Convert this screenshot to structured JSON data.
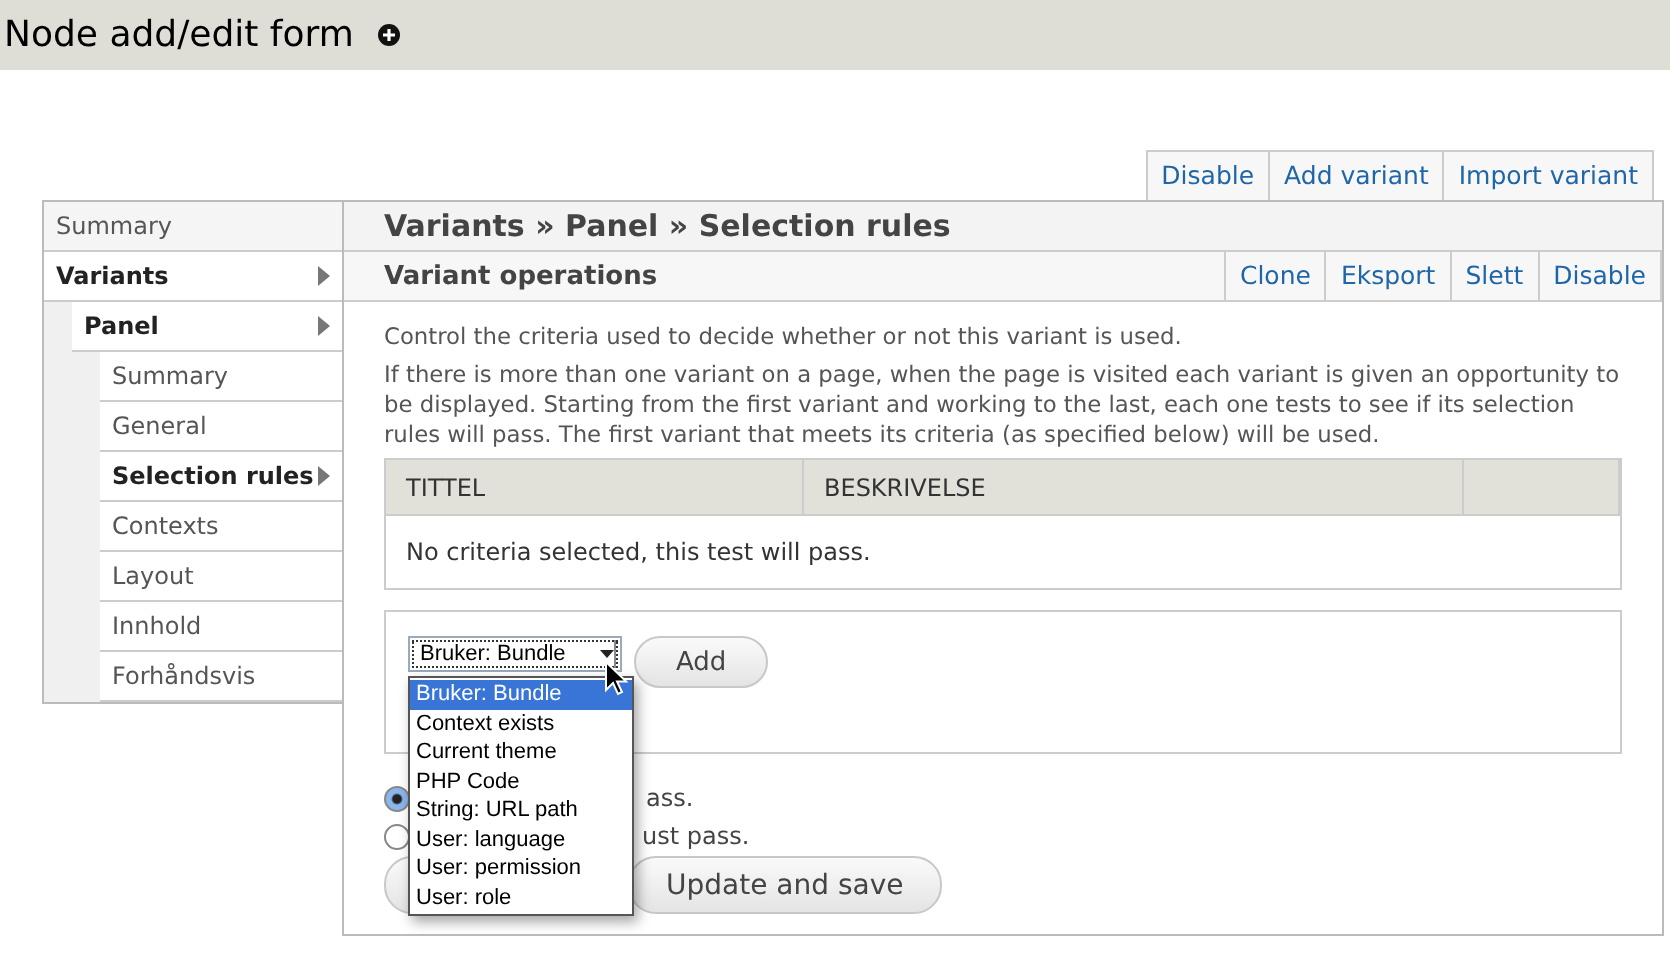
{
  "header": {
    "title": "Node add/edit form"
  },
  "top_actions": [
    "Disable",
    "Add variant",
    "Import variant"
  ],
  "sidebar": {
    "items": [
      {
        "label": "Summary",
        "active": false
      },
      {
        "label": "Variants",
        "active": true,
        "children": [
          {
            "label": "Panel",
            "active": true,
            "children": [
              {
                "label": "Summary",
                "active": false
              },
              {
                "label": "General",
                "active": false
              },
              {
                "label": "Selection rules",
                "active": true
              },
              {
                "label": "Contexts",
                "active": false
              },
              {
                "label": "Layout",
                "active": false
              },
              {
                "label": "Innhold",
                "active": false
              },
              {
                "label": "Forhåndsvis",
                "active": false
              }
            ]
          }
        ]
      }
    ]
  },
  "main": {
    "breadcrumb": "Variants » Panel » Selection rules",
    "operations": {
      "title": "Variant operations",
      "actions": [
        "Clone",
        "Eksport",
        "Slett",
        "Disable"
      ]
    },
    "intro": "Control the criteria used to decide whether or not this variant is used.",
    "description": "If there is more than one variant on a page, when the page is visited each variant is given an opportunity to be displayed. Starting from the first variant and working to the last, each one tests to see if its selection rules will pass. The first variant that meets its criteria (as specified below) will be used.",
    "table": {
      "columns": [
        "TITTEL",
        "BESKRIVELSE"
      ],
      "empty_text": "No criteria selected, this test will pass."
    },
    "criteria": {
      "select": {
        "value": "Bruker: Bundle",
        "expanded": true,
        "options": [
          {
            "label": "Bruker: Bundle",
            "selected": true
          },
          {
            "label": "Context exists",
            "selected": false
          },
          {
            "label": "Current theme",
            "selected": false
          },
          {
            "label": "PHP Code",
            "selected": false
          },
          {
            "label": "String: URL path",
            "selected": false
          },
          {
            "label": "User: language",
            "selected": false
          },
          {
            "label": "User: permission",
            "selected": false
          },
          {
            "label": "User: role",
            "selected": false
          }
        ]
      },
      "add_button": "Add"
    },
    "logic": [
      {
        "label": "ass.",
        "selected": true
      },
      {
        "label": "ust pass.",
        "selected": false
      }
    ],
    "buttons": [
      "Update and save"
    ]
  }
}
